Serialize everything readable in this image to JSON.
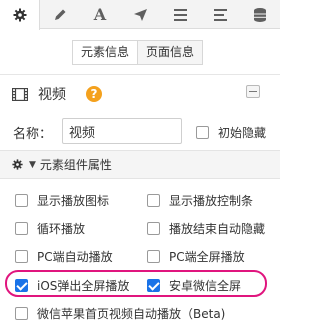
{
  "toolbar": {
    "tabs": [
      {
        "icon": "gear-icon",
        "active": true
      },
      {
        "icon": "pencil-icon"
      },
      {
        "icon": "font-icon",
        "glyph": "A"
      },
      {
        "icon": "send-icon"
      },
      {
        "icon": "list-icon"
      },
      {
        "icon": "bars-icon"
      },
      {
        "icon": "database-icon"
      }
    ]
  },
  "subtabs": {
    "element_info": "元素信息",
    "page_info": "页面信息"
  },
  "element": {
    "icon": "film-icon",
    "title": "视频",
    "help": "?"
  },
  "name_row": {
    "label": "名称：",
    "value": "视频",
    "initial_hidden": "初始隐藏"
  },
  "section": {
    "title": "元素组件属性"
  },
  "options": {
    "show_play_icon": {
      "label": "显示播放图标",
      "checked": false
    },
    "show_play_controls": {
      "label": "显示播放控制条",
      "checked": false
    },
    "loop_play": {
      "label": "循环播放",
      "checked": false
    },
    "auto_hide_after_end": {
      "label": "播放结束自动隐藏",
      "checked": false
    },
    "pc_autoplay": {
      "label": "PC端自动播放",
      "checked": false
    },
    "pc_fullscreen": {
      "label": "PC端全屏播放",
      "checked": false
    },
    "ios_popup_fullscreen": {
      "label": "iOS弹出全屏播放",
      "checked": true
    },
    "android_wechat_fullscreen": {
      "label": "安卓微信全屏",
      "checked": true
    },
    "wechat_apple_autoplay": {
      "label": "微信苹果首页视频自动播放（Beta)",
      "checked": false
    }
  },
  "colors": {
    "checkbox_checked": "#1a73e8",
    "highlight_ring": "#e0157e",
    "help_badge": "#f4a11d"
  }
}
